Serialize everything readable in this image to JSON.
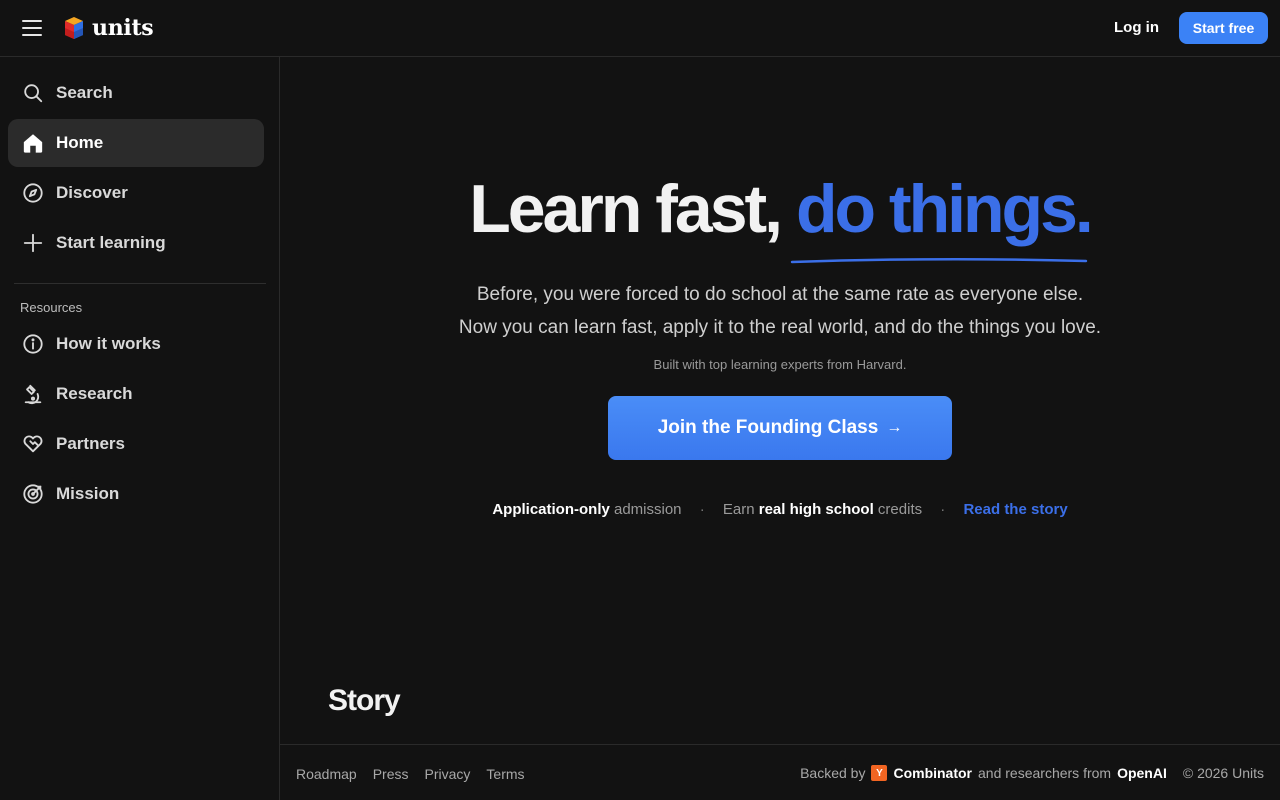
{
  "header": {
    "logo_text": "units",
    "login_label": "Log in",
    "start_label": "Start free",
    "accent_color": "#3b82f6"
  },
  "sidebar": {
    "items": [
      {
        "label": "Search",
        "icon": "search-icon"
      },
      {
        "label": "Home",
        "icon": "home-icon",
        "active": true
      },
      {
        "label": "Discover",
        "icon": "compass-icon"
      },
      {
        "label": "Start learning",
        "icon": "plus-icon"
      }
    ],
    "resources_label": "Resources",
    "resources": [
      {
        "label": "How it works",
        "icon": "info-icon"
      },
      {
        "label": "Research",
        "icon": "microscope-icon"
      },
      {
        "label": "Partners",
        "icon": "handshake-heart-icon"
      },
      {
        "label": "Mission",
        "icon": "target-icon"
      }
    ]
  },
  "hero": {
    "title_part1": "Learn fast, ",
    "title_accent": "do things.",
    "subtitle_line1": "Before, you were forced to do school at the same rate as everyone else.",
    "subtitle_line2": "Now you can learn fast, apply it to the real world, and do the things you love.",
    "built_with": "Built with top learning experts from Harvard.",
    "cta_label": "Join the Founding Class",
    "cta_arrow": "→",
    "facts": {
      "f1_bold": "Application-only",
      "f1_rest": " admission",
      "sep": "·",
      "f2_pre": "Earn ",
      "f2_bold": "real high school",
      "f2_rest": " credits",
      "story_link": "Read the story"
    }
  },
  "story": {
    "heading": "Story"
  },
  "footer": {
    "links": [
      "Roadmap",
      "Press",
      "Privacy",
      "Terms"
    ],
    "backed_by": "Backed by",
    "yc_letter": "Y",
    "combinator": "Combinator",
    "researchers_from": "and researchers from",
    "openai": "OpenAI",
    "copyright": "© 2026 Units"
  }
}
